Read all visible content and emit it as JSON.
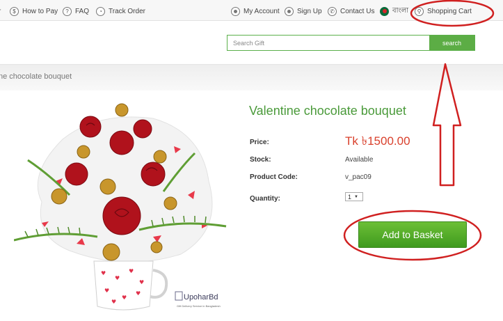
{
  "nav": {
    "partial_item": "r",
    "how_to_pay": "How to Pay",
    "faq": "FAQ",
    "track_order": "Track Order",
    "my_account": "My Account",
    "sign_up": "Sign Up",
    "contact_us": "Contact Us",
    "language": "বাংলা",
    "shopping_cart": "Shopping Cart"
  },
  "search": {
    "placeholder": "Search Gift",
    "button_label": "search"
  },
  "breadcrumb": {
    "current": "ne chocolate bouquet"
  },
  "product": {
    "title": "Valentine chocolate bouquet",
    "price_label": "Price:",
    "price_value": "Tk ৳1500.00",
    "stock_label": "Stock:",
    "stock_value": "Available",
    "code_label": "Product Code:",
    "code_value": "v_pac09",
    "quantity_label": "Quantity:",
    "quantity_value": "1",
    "add_button": "Add to Basket"
  },
  "image": {
    "brand": "UpoharBd",
    "tagline": "Gift Delivery Service in Bangladesh"
  },
  "colors": {
    "accent_green": "#5cad45",
    "title_green": "#4a9a3a",
    "price_red": "#d9402c",
    "annotation_red": "#d02020"
  }
}
